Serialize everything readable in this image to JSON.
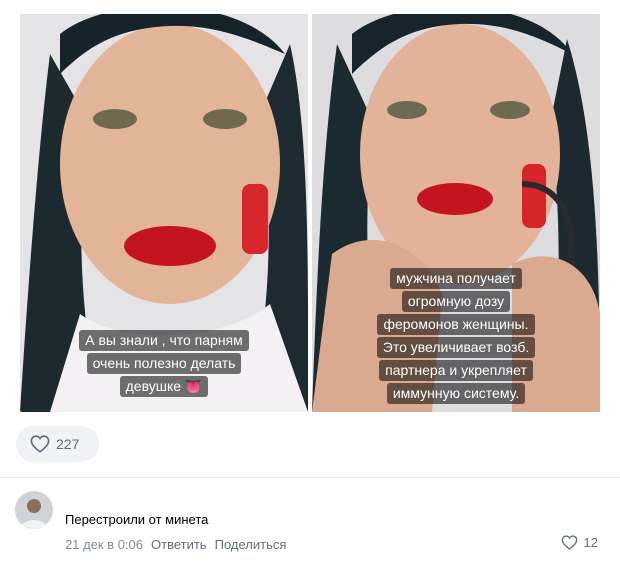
{
  "post": {
    "photos": [
      {
        "caption_lines": [
          "А вы знали , что парням",
          "очень полезно делать",
          "девушке 👅"
        ]
      },
      {
        "caption_lines": [
          "мужчина получает",
          "огромную дозу",
          "феромонов женщины.",
          "Это увеличивает возб.",
          "партнера и укрепляет",
          "иммунную систему."
        ]
      }
    ],
    "likes": {
      "icon": "heart-icon",
      "count": "227"
    }
  },
  "comment": {
    "text": "Перестроили от минета",
    "date": "21 дек в 0:06",
    "reply_label": "Ответить",
    "share_label": "Поделиться",
    "likes": {
      "icon": "heart-icon",
      "count": "12"
    }
  },
  "colors": {
    "meta_gray": "#818c99",
    "action_gray": "#626d7a",
    "pill_bg": "#f0f2f5",
    "divider": "#e7e8ec"
  }
}
